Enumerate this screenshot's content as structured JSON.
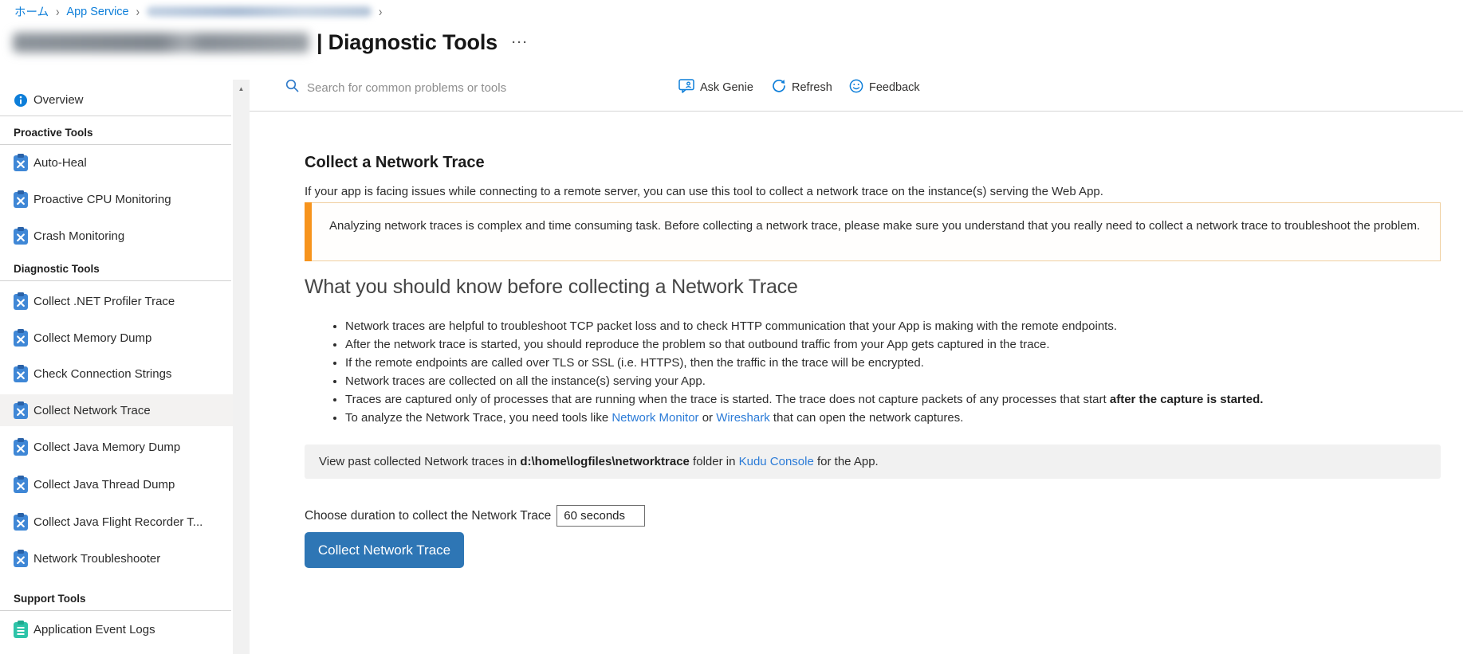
{
  "colors": {
    "accent": "#0d7ed9",
    "warning_accent": "#f7941d",
    "button": "#2e76b5",
    "link": "#2b7bd7",
    "selected_bg": "#f3f2f1"
  },
  "breadcrumb": {
    "home": "ホーム",
    "app_service": "App Service",
    "separator": "›"
  },
  "header": {
    "title": "| Diagnostic Tools",
    "ellipsis": "···"
  },
  "toolbar": {
    "search_placeholder": "Search for common problems or tools",
    "ask_genie": "Ask Genie",
    "refresh": "Refresh",
    "feedback": "Feedback"
  },
  "scrollbar": {
    "up_arrow": "▲"
  },
  "sidebar": {
    "overview": {
      "label": "Overview",
      "icon": "info-icon"
    },
    "sections": [
      {
        "title": "Proactive Tools",
        "items": [
          {
            "label": "Auto-Heal",
            "icon": "diagnose-tool-icon",
            "selected": false
          },
          {
            "label": "Proactive CPU Monitoring",
            "icon": "diagnose-tool-icon",
            "selected": false
          },
          {
            "label": "Crash Monitoring",
            "icon": "diagnose-tool-icon",
            "selected": false
          }
        ]
      },
      {
        "title": "Diagnostic Tools",
        "items": [
          {
            "label": "Collect .NET Profiler Trace",
            "icon": "diagnose-tool-icon",
            "selected": false
          },
          {
            "label": "Collect Memory Dump",
            "icon": "diagnose-tool-icon",
            "selected": false
          },
          {
            "label": "Check Connection Strings",
            "icon": "diagnose-tool-icon",
            "selected": false
          },
          {
            "label": "Collect Network Trace",
            "icon": "diagnose-tool-icon",
            "selected": true
          },
          {
            "label": "Collect Java Memory Dump",
            "icon": "diagnose-tool-icon",
            "selected": false
          },
          {
            "label": "Collect Java Thread Dump",
            "icon": "diagnose-tool-icon",
            "selected": false
          },
          {
            "label": "Collect Java Flight Recorder T...",
            "icon": "diagnose-tool-icon",
            "selected": false
          },
          {
            "label": "Network Troubleshooter",
            "icon": "diagnose-tool-icon",
            "selected": false
          }
        ]
      },
      {
        "title": "Support Tools",
        "items": [
          {
            "label": "Application Event Logs",
            "icon": "event-logs-icon",
            "selected": false
          }
        ]
      }
    ]
  },
  "main": {
    "heading": "Collect a Network Trace",
    "intro": "If your app is facing issues while connecting to a remote server, you can use this tool to collect a network trace on the instance(s) serving the Web App.",
    "warning": "Analyzing network traces is complex and time consuming task. Before collecting a network trace, please make sure you understand that you really need to collect a network trace to troubleshoot the problem.",
    "section_heading": "What you should know before collecting a Network Trace",
    "bullets": [
      [
        {
          "t": "Network traces are helpful to troubleshoot TCP packet loss and to check HTTP communication that your App is making with the remote endpoints.",
          "s": "n"
        }
      ],
      [
        {
          "t": "After the network trace is started, you should reproduce the problem so that outbound traffic from your App gets captured in the trace.",
          "s": "n"
        }
      ],
      [
        {
          "t": "If the remote endpoints are called over TLS or SSL (i.e. HTTPS), then the traffic in the trace will be encrypted.",
          "s": "n"
        }
      ],
      [
        {
          "t": "Network traces are collected on all the instance(s) serving your App.",
          "s": "n"
        }
      ],
      [
        {
          "t": "Traces are captured only of processes that are running when the trace is started. The trace does not capture packets of any processes that start ",
          "s": "n"
        },
        {
          "t": "after the capture is started.",
          "s": "b"
        }
      ],
      [
        {
          "t": "To analyze the Network Trace, you need tools like ",
          "s": "n"
        },
        {
          "t": "Network Monitor",
          "s": "l"
        },
        {
          "t": " or ",
          "s": "n"
        },
        {
          "t": "Wireshark",
          "s": "l"
        },
        {
          "t": " that can open the network captures.",
          "s": "n"
        }
      ]
    ],
    "info_bar": [
      {
        "t": "View past collected Network traces in ",
        "s": "n"
      },
      {
        "t": "d:\\home\\logfiles\\networktrace",
        "s": "b"
      },
      {
        "t": " folder in ",
        "s": "n"
      },
      {
        "t": "Kudu Console",
        "s": "l"
      },
      {
        "t": " for the App.",
        "s": "n"
      }
    ],
    "duration_label": "Choose duration to collect the Network Trace",
    "duration_value": "60 seconds",
    "collect_button": "Collect Network Trace"
  }
}
